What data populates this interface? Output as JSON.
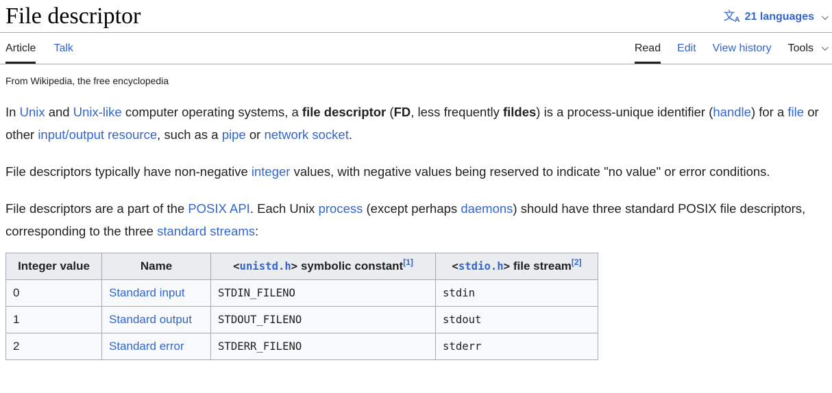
{
  "meta": {
    "colors": {
      "text": "#202122",
      "link": "#3366cc",
      "border": "#a2a9b1",
      "table_header_bg": "#eaecf0",
      "table_row_bg": "#f8f9fa",
      "active_tab_underline": "#202122"
    },
    "icons": [
      "language-icon (文A)",
      "chevron-down-icon (languages)",
      "chevron-down-icon (tools)"
    ]
  },
  "header": {
    "title": "File descriptor",
    "languages": {
      "icon_main": "文",
      "icon_sub": "A",
      "label": "21 languages"
    }
  },
  "tabs": {
    "article": "Article",
    "talk": "Talk",
    "read": "Read",
    "edit": "Edit",
    "view_history": "View history",
    "tools": "Tools"
  },
  "subtitle": "From Wikipedia, the free encyclopedia",
  "paragraphs": [
    [
      {
        "t": "In "
      },
      {
        "t": "Unix",
        "link": true
      },
      {
        "t": " and "
      },
      {
        "t": "Unix-like",
        "link": true
      },
      {
        "t": " computer operating systems, a "
      },
      {
        "t": "file descriptor",
        "bold": true
      },
      {
        "t": " ("
      },
      {
        "t": "FD",
        "bold": true
      },
      {
        "t": ", less frequently "
      },
      {
        "t": "fildes",
        "bold": true
      },
      {
        "t": ") is a process-unique identifier ("
      },
      {
        "t": "handle",
        "link": true
      },
      {
        "t": ") for a "
      },
      {
        "t": "file",
        "link": true
      },
      {
        "t": " or other "
      },
      {
        "t": "input/output resource",
        "link": true
      },
      {
        "t": ", such as a "
      },
      {
        "t": "pipe",
        "link": true
      },
      {
        "t": " or "
      },
      {
        "t": "network socket",
        "link": true
      },
      {
        "t": "."
      }
    ],
    [
      {
        "t": "File descriptors typically have non-negative "
      },
      {
        "t": "integer",
        "link": true
      },
      {
        "t": " values, with negative values being reserved to indicate \"no value\" or error conditions."
      }
    ],
    [
      {
        "t": "File descriptors are a part of the "
      },
      {
        "t": "POSIX API",
        "link": true
      },
      {
        "t": ". Each Unix "
      },
      {
        "t": "process",
        "link": true
      },
      {
        "t": " (except perhaps "
      },
      {
        "t": "daemons",
        "link": true
      },
      {
        "t": ") should have three standard POSIX file descriptors, corresponding to the three "
      },
      {
        "t": "standard streams",
        "link": true
      },
      {
        "t": ":"
      }
    ]
  ],
  "table": {
    "header": [
      [
        {
          "t": "Integer value"
        }
      ],
      [
        {
          "t": "Name"
        }
      ],
      [
        {
          "t": "<",
          "mono": true
        },
        {
          "t": "unistd.h",
          "mono": true,
          "link": true
        },
        {
          "t": ">",
          "mono": true
        },
        {
          "t": " symbolic constant"
        },
        {
          "t": "[1]",
          "sup": true,
          "link": true
        }
      ],
      [
        {
          "t": "<",
          "mono": true
        },
        {
          "t": "stdio.h",
          "mono": true,
          "link": true
        },
        {
          "t": ">",
          "mono": true
        },
        {
          "t": " file stream"
        },
        {
          "t": "[2]",
          "sup": true,
          "link": true
        }
      ]
    ],
    "rows": [
      [
        [
          {
            "t": "0"
          }
        ],
        [
          {
            "t": "Standard input",
            "link": true
          }
        ],
        [
          {
            "t": "STDIN_FILENO",
            "mono": true
          }
        ],
        [
          {
            "t": "stdin",
            "mono": true
          }
        ]
      ],
      [
        [
          {
            "t": "1"
          }
        ],
        [
          {
            "t": "Standard output",
            "link": true
          }
        ],
        [
          {
            "t": "STDOUT_FILENO",
            "mono": true
          }
        ],
        [
          {
            "t": "stdout",
            "mono": true
          }
        ]
      ],
      [
        [
          {
            "t": "2"
          }
        ],
        [
          {
            "t": "Standard error",
            "link": true
          }
        ],
        [
          {
            "t": "STDERR_FILENO",
            "mono": true
          }
        ],
        [
          {
            "t": "stderr",
            "mono": true
          }
        ]
      ]
    ]
  }
}
